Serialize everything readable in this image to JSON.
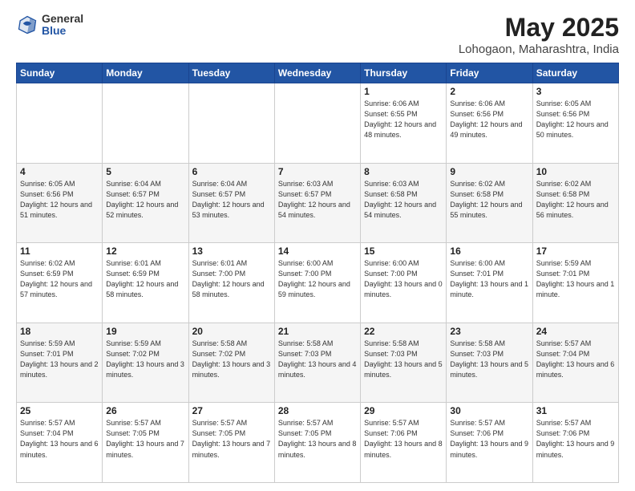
{
  "logo": {
    "general": "General",
    "blue": "Blue"
  },
  "title": "May 2025",
  "subtitle": "Lohogaon, Maharashtra, India",
  "headers": [
    "Sunday",
    "Monday",
    "Tuesday",
    "Wednesday",
    "Thursday",
    "Friday",
    "Saturday"
  ],
  "rows": [
    [
      {
        "date": "",
        "info": ""
      },
      {
        "date": "",
        "info": ""
      },
      {
        "date": "",
        "info": ""
      },
      {
        "date": "",
        "info": ""
      },
      {
        "date": "1",
        "info": "Sunrise: 6:06 AM\nSunset: 6:55 PM\nDaylight: 12 hours\nand 48 minutes."
      },
      {
        "date": "2",
        "info": "Sunrise: 6:06 AM\nSunset: 6:56 PM\nDaylight: 12 hours\nand 49 minutes."
      },
      {
        "date": "3",
        "info": "Sunrise: 6:05 AM\nSunset: 6:56 PM\nDaylight: 12 hours\nand 50 minutes."
      }
    ],
    [
      {
        "date": "4",
        "info": "Sunrise: 6:05 AM\nSunset: 6:56 PM\nDaylight: 12 hours\nand 51 minutes."
      },
      {
        "date": "5",
        "info": "Sunrise: 6:04 AM\nSunset: 6:57 PM\nDaylight: 12 hours\nand 52 minutes."
      },
      {
        "date": "6",
        "info": "Sunrise: 6:04 AM\nSunset: 6:57 PM\nDaylight: 12 hours\nand 53 minutes."
      },
      {
        "date": "7",
        "info": "Sunrise: 6:03 AM\nSunset: 6:57 PM\nDaylight: 12 hours\nand 54 minutes."
      },
      {
        "date": "8",
        "info": "Sunrise: 6:03 AM\nSunset: 6:58 PM\nDaylight: 12 hours\nand 54 minutes."
      },
      {
        "date": "9",
        "info": "Sunrise: 6:02 AM\nSunset: 6:58 PM\nDaylight: 12 hours\nand 55 minutes."
      },
      {
        "date": "10",
        "info": "Sunrise: 6:02 AM\nSunset: 6:58 PM\nDaylight: 12 hours\nand 56 minutes."
      }
    ],
    [
      {
        "date": "11",
        "info": "Sunrise: 6:02 AM\nSunset: 6:59 PM\nDaylight: 12 hours\nand 57 minutes."
      },
      {
        "date": "12",
        "info": "Sunrise: 6:01 AM\nSunset: 6:59 PM\nDaylight: 12 hours\nand 58 minutes."
      },
      {
        "date": "13",
        "info": "Sunrise: 6:01 AM\nSunset: 7:00 PM\nDaylight: 12 hours\nand 58 minutes."
      },
      {
        "date": "14",
        "info": "Sunrise: 6:00 AM\nSunset: 7:00 PM\nDaylight: 12 hours\nand 59 minutes."
      },
      {
        "date": "15",
        "info": "Sunrise: 6:00 AM\nSunset: 7:00 PM\nDaylight: 13 hours\nand 0 minutes."
      },
      {
        "date": "16",
        "info": "Sunrise: 6:00 AM\nSunset: 7:01 PM\nDaylight: 13 hours\nand 1 minute."
      },
      {
        "date": "17",
        "info": "Sunrise: 5:59 AM\nSunset: 7:01 PM\nDaylight: 13 hours\nand 1 minute."
      }
    ],
    [
      {
        "date": "18",
        "info": "Sunrise: 5:59 AM\nSunset: 7:01 PM\nDaylight: 13 hours\nand 2 minutes."
      },
      {
        "date": "19",
        "info": "Sunrise: 5:59 AM\nSunset: 7:02 PM\nDaylight: 13 hours\nand 3 minutes."
      },
      {
        "date": "20",
        "info": "Sunrise: 5:58 AM\nSunset: 7:02 PM\nDaylight: 13 hours\nand 3 minutes."
      },
      {
        "date": "21",
        "info": "Sunrise: 5:58 AM\nSunset: 7:03 PM\nDaylight: 13 hours\nand 4 minutes."
      },
      {
        "date": "22",
        "info": "Sunrise: 5:58 AM\nSunset: 7:03 PM\nDaylight: 13 hours\nand 5 minutes."
      },
      {
        "date": "23",
        "info": "Sunrise: 5:58 AM\nSunset: 7:03 PM\nDaylight: 13 hours\nand 5 minutes."
      },
      {
        "date": "24",
        "info": "Sunrise: 5:57 AM\nSunset: 7:04 PM\nDaylight: 13 hours\nand 6 minutes."
      }
    ],
    [
      {
        "date": "25",
        "info": "Sunrise: 5:57 AM\nSunset: 7:04 PM\nDaylight: 13 hours\nand 6 minutes."
      },
      {
        "date": "26",
        "info": "Sunrise: 5:57 AM\nSunset: 7:05 PM\nDaylight: 13 hours\nand 7 minutes."
      },
      {
        "date": "27",
        "info": "Sunrise: 5:57 AM\nSunset: 7:05 PM\nDaylight: 13 hours\nand 7 minutes."
      },
      {
        "date": "28",
        "info": "Sunrise: 5:57 AM\nSunset: 7:05 PM\nDaylight: 13 hours\nand 8 minutes."
      },
      {
        "date": "29",
        "info": "Sunrise: 5:57 AM\nSunset: 7:06 PM\nDaylight: 13 hours\nand 8 minutes."
      },
      {
        "date": "30",
        "info": "Sunrise: 5:57 AM\nSunset: 7:06 PM\nDaylight: 13 hours\nand 9 minutes."
      },
      {
        "date": "31",
        "info": "Sunrise: 5:57 AM\nSunset: 7:06 PM\nDaylight: 13 hours\nand 9 minutes."
      }
    ]
  ]
}
